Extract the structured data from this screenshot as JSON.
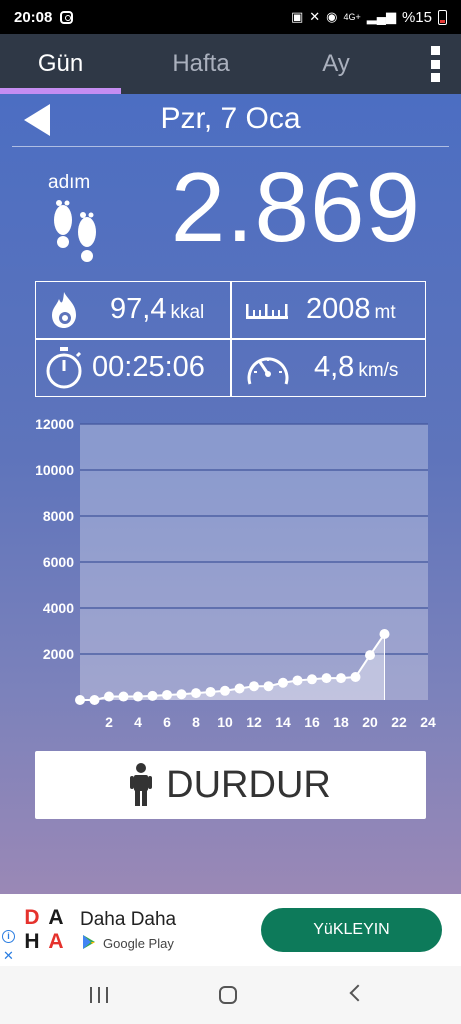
{
  "status_bar": {
    "time": "20:08",
    "network": "4G+",
    "battery": "%15"
  },
  "tabs": [
    {
      "label": "Gün",
      "active": true
    },
    {
      "label": "Hafta",
      "active": false
    },
    {
      "label": "Ay",
      "active": false
    }
  ],
  "date": "Pzr, 7 Oca",
  "steps": {
    "label": "adım",
    "value": "2.869"
  },
  "stats": {
    "calories": {
      "value": "97,4",
      "unit": "kkal"
    },
    "distance": {
      "value": "2008",
      "unit": "mt"
    },
    "duration": {
      "value": "00:25:06"
    },
    "speed": {
      "value": "4,8",
      "unit": "km/s"
    }
  },
  "chart_data": {
    "type": "area",
    "y_ticks": [
      "12000",
      "10000",
      "8000",
      "6000",
      "4000",
      "2000"
    ],
    "x_ticks": [
      "2",
      "4",
      "6",
      "8",
      "10",
      "12",
      "14",
      "16",
      "18",
      "20",
      "22",
      "24"
    ],
    "xlim": [
      0,
      24
    ],
    "ylim": [
      0,
      12000
    ],
    "grid": true,
    "x": [
      0,
      1,
      2,
      3,
      4,
      5,
      6,
      7,
      8,
      9,
      10,
      11,
      12,
      13,
      14,
      15,
      16,
      17,
      18,
      19,
      20,
      21
    ],
    "y": [
      0,
      0,
      150,
      150,
      150,
      180,
      220,
      250,
      300,
      350,
      400,
      500,
      600,
      600,
      750,
      850,
      900,
      950,
      950,
      1000,
      1950,
      2869
    ]
  },
  "stop_button": {
    "label": "DURDUR"
  },
  "ad": {
    "title": "Daha Daha",
    "store": "Google Play",
    "cta": "YüKLEYIN",
    "logo_letters": [
      "D",
      "A",
      "H",
      "A"
    ],
    "logo_colors": [
      "#e5322d",
      "#1a1a1a",
      "#1a1a1a",
      "#e5322d"
    ]
  },
  "colors": {
    "accent": "#c58df2",
    "tab_bg": "#2f3846",
    "install_green": "#0d7a5a"
  }
}
